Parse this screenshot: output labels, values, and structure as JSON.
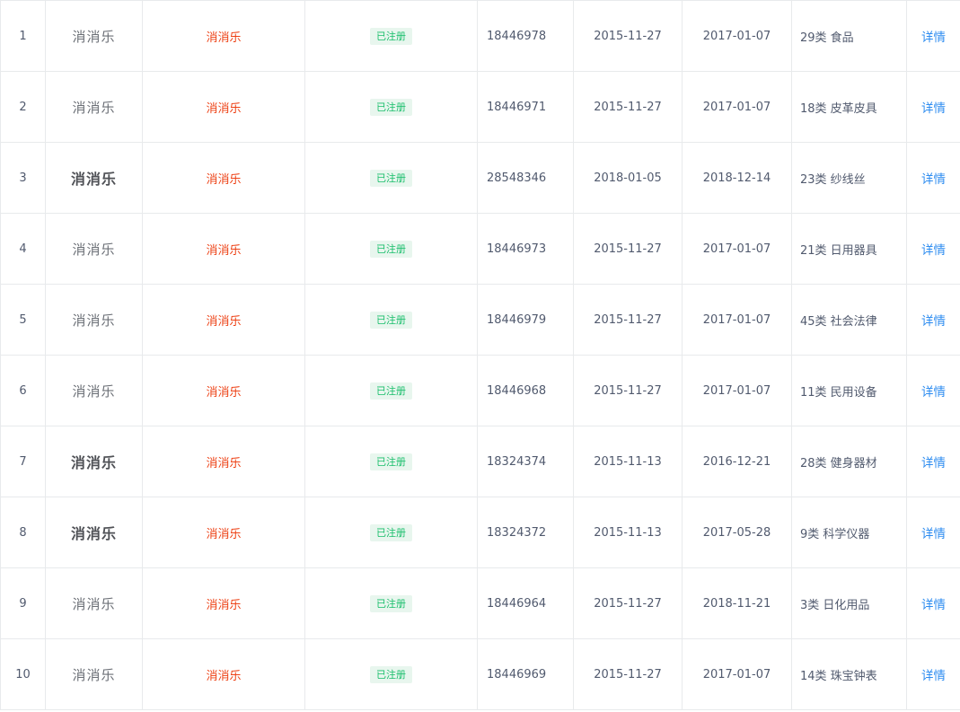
{
  "rows": [
    {
      "index": "1",
      "logo": "消消乐",
      "logo_bold": false,
      "name": "消消乐",
      "status": "已注册",
      "reg_no": "18446978",
      "apply_date": "2015-11-27",
      "reg_date": "2017-01-07",
      "class": "29类 食品",
      "detail": "详情"
    },
    {
      "index": "2",
      "logo": "消消乐",
      "logo_bold": false,
      "name": "消消乐",
      "status": "已注册",
      "reg_no": "18446971",
      "apply_date": "2015-11-27",
      "reg_date": "2017-01-07",
      "class": "18类 皮革皮具",
      "detail": "详情"
    },
    {
      "index": "3",
      "logo": "消消乐",
      "logo_bold": true,
      "name": "消消乐",
      "status": "已注册",
      "reg_no": "28548346",
      "apply_date": "2018-01-05",
      "reg_date": "2018-12-14",
      "class": "23类 纱线丝",
      "detail": "详情"
    },
    {
      "index": "4",
      "logo": "消消乐",
      "logo_bold": false,
      "name": "消消乐",
      "status": "已注册",
      "reg_no": "18446973",
      "apply_date": "2015-11-27",
      "reg_date": "2017-01-07",
      "class": "21类 日用器具",
      "detail": "详情"
    },
    {
      "index": "5",
      "logo": "消消乐",
      "logo_bold": false,
      "name": "消消乐",
      "status": "已注册",
      "reg_no": "18446979",
      "apply_date": "2015-11-27",
      "reg_date": "2017-01-07",
      "class": "45类 社会法律",
      "detail": "详情"
    },
    {
      "index": "6",
      "logo": "消消乐",
      "logo_bold": false,
      "name": "消消乐",
      "status": "已注册",
      "reg_no": "18446968",
      "apply_date": "2015-11-27",
      "reg_date": "2017-01-07",
      "class": "11类 民用设备",
      "detail": "详情"
    },
    {
      "index": "7",
      "logo": "消消乐",
      "logo_bold": true,
      "name": "消消乐",
      "status": "已注册",
      "reg_no": "18324374",
      "apply_date": "2015-11-13",
      "reg_date": "2016-12-21",
      "class": "28类 健身器材",
      "detail": "详情"
    },
    {
      "index": "8",
      "logo": "消消乐",
      "logo_bold": true,
      "name": "消消乐",
      "status": "已注册",
      "reg_no": "18324372",
      "apply_date": "2015-11-13",
      "reg_date": "2017-05-28",
      "class": "9类 科学仪器",
      "detail": "详情"
    },
    {
      "index": "9",
      "logo": "消消乐",
      "logo_bold": false,
      "name": "消消乐",
      "status": "已注册",
      "reg_no": "18446964",
      "apply_date": "2015-11-27",
      "reg_date": "2018-11-21",
      "class": "3类 日化用品",
      "detail": "详情"
    },
    {
      "index": "10",
      "logo": "消消乐",
      "logo_bold": false,
      "name": "消消乐",
      "status": "已注册",
      "reg_no": "18446969",
      "apply_date": "2015-11-27",
      "reg_date": "2017-01-07",
      "class": "14类 珠宝钟表",
      "detail": "详情"
    }
  ],
  "colors": {
    "name": "#ed4014",
    "status_text": "#19be6b",
    "status_bg": "#e8f6ee",
    "link": "#2d8cf0",
    "border": "#e8eaec"
  }
}
